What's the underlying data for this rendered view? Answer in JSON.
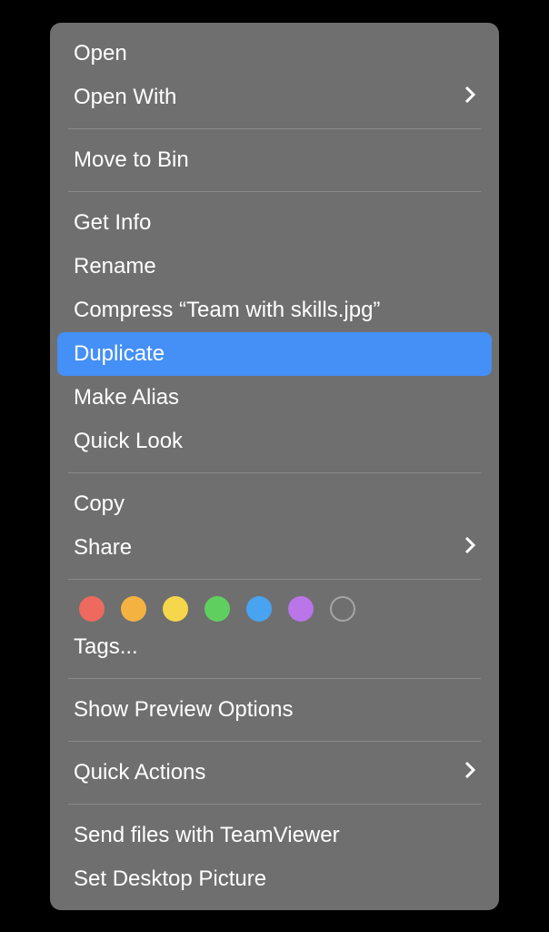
{
  "menu": {
    "open": "Open",
    "openWith": "Open With",
    "moveToBin": "Move to Bin",
    "getInfo": "Get Info",
    "rename": "Rename",
    "compress": "Compress “Team with skills.jpg”",
    "duplicate": "Duplicate",
    "makeAlias": "Make Alias",
    "quickLook": "Quick Look",
    "copy": "Copy",
    "share": "Share",
    "tags": "Tags...",
    "showPreviewOptions": "Show Preview Options",
    "quickActions": "Quick Actions",
    "sendFilesTeamviewer": "Send files with TeamViewer",
    "setDesktopPicture": "Set Desktop Picture"
  },
  "tagColors": {
    "red": "#ee6a5e",
    "orange": "#f4b341",
    "yellow": "#f6d64b",
    "green": "#5fd060",
    "blue": "#4aa3f1",
    "purple": "#ba75e8"
  },
  "highlighted": "duplicate"
}
